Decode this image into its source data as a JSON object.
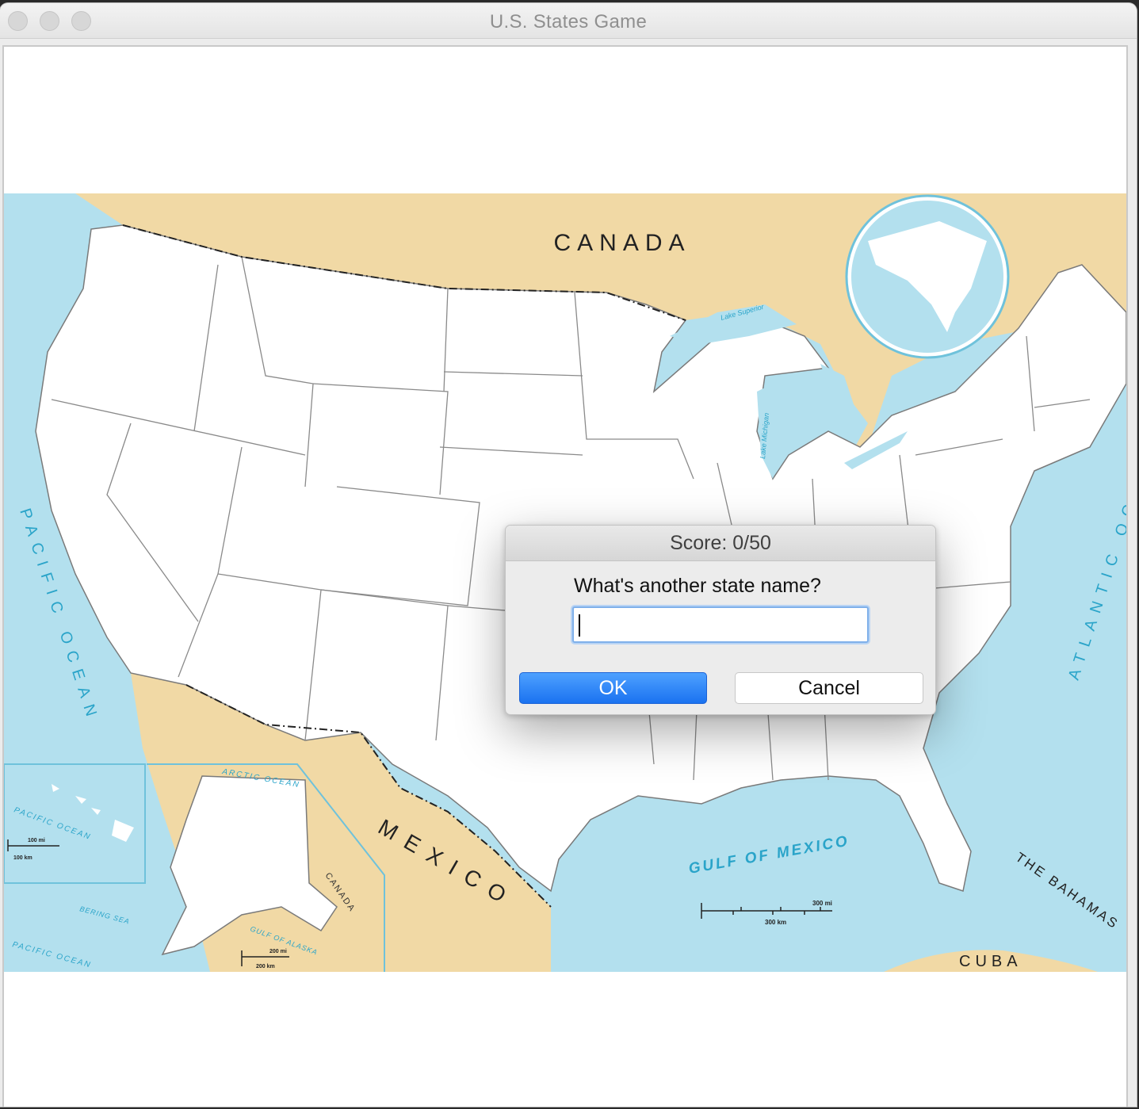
{
  "window": {
    "title": "U.S. States Game"
  },
  "map": {
    "labels": {
      "canada": "CANADA",
      "mexico": "MEXICO",
      "pacific_ocean": "PACIFIC OCEAN",
      "atlantic_ocean": "ATLANTIC OCEAN",
      "gulf_of_mexico": "GULF OF MEXICO",
      "the_bahamas": "THE BAHAMAS",
      "cuba": "CUBA",
      "arctic_ocean": "ARCTIC OCEAN",
      "bering_sea": "BERING SEA",
      "gulf_of_alaska": "GULF OF ALASKA",
      "canada_small": "CANADA",
      "pacific_ocean_hawaii": "PACIFIC OCEAN",
      "pacific_ocean_alaska": "PACIFIC OCEAN",
      "lake_superior": "Lake Superior",
      "lake_michigan": "Lake Michigan",
      "scale_100mi": "100 mi",
      "scale_100km": "100 km",
      "scale_200mi": "200 mi",
      "scale_200km": "200 km",
      "scale_main_mi": "300 mi",
      "scale_main_km": "300 km"
    },
    "colors": {
      "water": "#b3e0ee",
      "land_foreign": "#f1d9a5",
      "land_us": "#ffffff",
      "borders": "#8a8a8a"
    }
  },
  "dialog": {
    "title": "Score: 0/50",
    "prompt": "What's another state name?",
    "input_value": "",
    "ok_label": "OK",
    "cancel_label": "Cancel"
  }
}
